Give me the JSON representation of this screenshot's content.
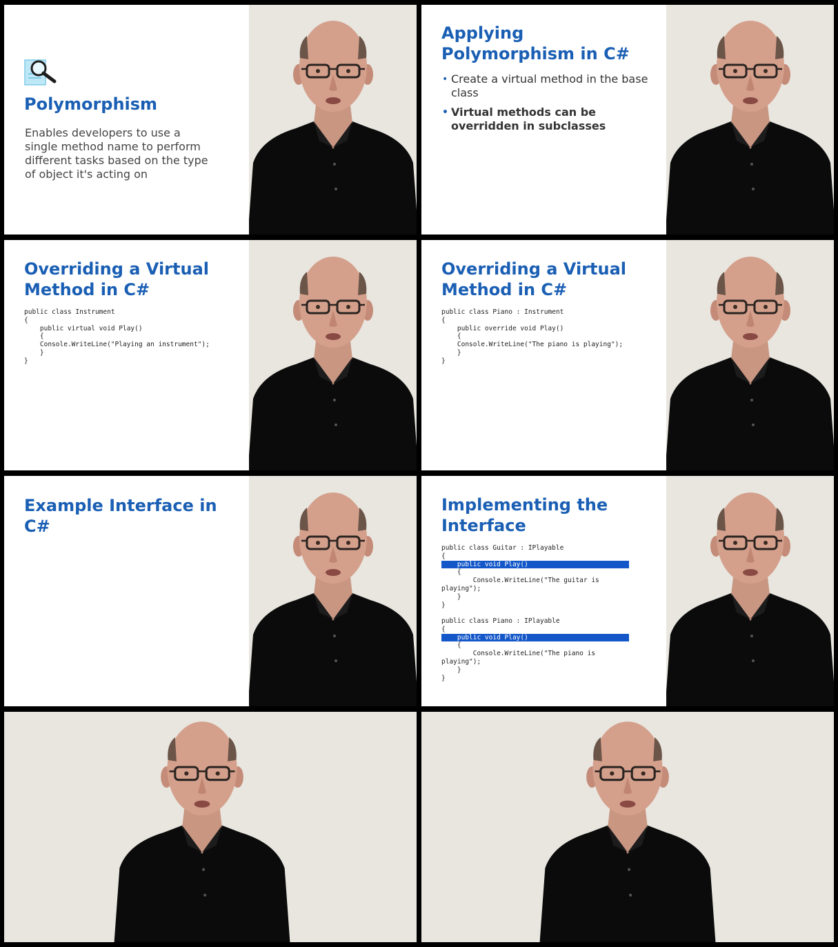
{
  "slides": [
    {
      "title": "Polymorphism",
      "icon": "magnifier-document-icon",
      "body": "Enables developers to use a single method name to perform different tasks based on the type of object it's acting on"
    },
    {
      "title": "Applying Polymorphism in C#",
      "bullets": [
        "Create a virtual method in the base class",
        "Virtual methods can be overridden in subclasses"
      ]
    },
    {
      "title": "Overriding a Virtual Method in C#",
      "code": "public class Instrument\n{\n    public virtual void Play()\n    {\n    Console.WriteLine(\"Playing an instrument\");\n    }\n}"
    },
    {
      "title": "Overriding a Virtual Method in C#",
      "code": "public class Piano : Instrument\n{\n    public override void Play()\n    {\n    Console.WriteLine(\"The piano is playing\");\n    }\n}"
    },
    {
      "title": "Example Interface in C#"
    },
    {
      "title": "Implementing the Interface",
      "code_a_pre": "public class Guitar : IPlayable\n{",
      "code_a_hl": "    public void Play()",
      "code_a_post": "    {\n        Console.WriteLine(\"The guitar is\nplaying\");\n    }\n}",
      "code_b_pre": "public class Piano : IPlayable\n{",
      "code_b_hl": "    public void Play()",
      "code_b_post": "    {\n        Console.WriteLine(\"The piano is\nplaying\");\n    }\n}"
    }
  ],
  "colors": {
    "title_blue": "#1a5fb4",
    "highlight_blue": "#1357c9",
    "camera_background": "#e8e6df",
    "shirt": "#0b0b0b"
  }
}
